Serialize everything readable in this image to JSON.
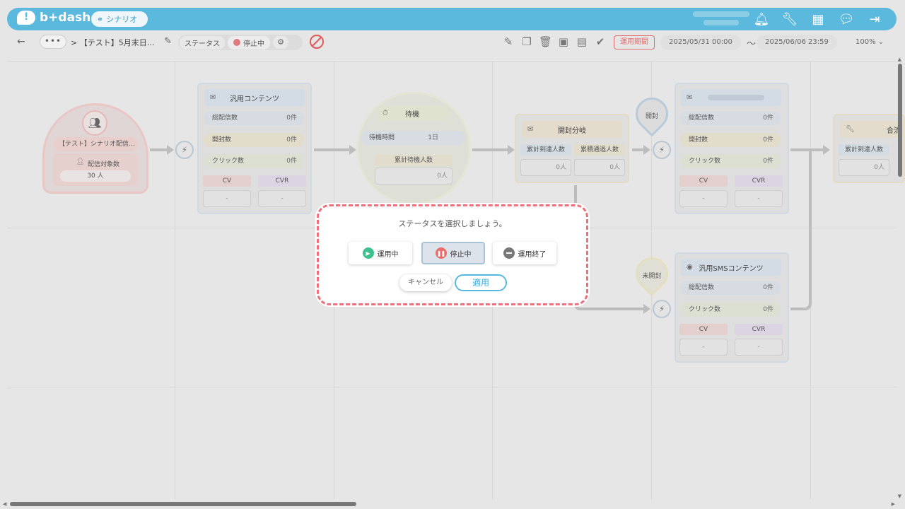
{
  "header": {
    "logo": "b+dash",
    "scenario_chip": "シナリオ",
    "icons": [
      "bell-icon",
      "wrench-icon",
      "grid-icon",
      "chat-icon",
      "logout-icon"
    ]
  },
  "toolbar": {
    "back": "←",
    "more": "•••",
    "breadcrumb": "> 【テスト】5月末日…",
    "status_label": "ステータス",
    "status_value": "停止中",
    "period_badge": "運用期間",
    "start_date": "2025/05/31 00:00",
    "tilde": "〜",
    "end_date": "2025/06/06 23:59",
    "zoom": "100%"
  },
  "nodes": {
    "start": {
      "title": "【テスト】シナリオ配信…",
      "target_label": "配信対象数",
      "target_value": "30 人"
    },
    "content1": {
      "title": "汎用コンテンツ",
      "r1": "総配信数",
      "v1": "0件",
      "r2": "開封数",
      "v2": "0件",
      "r3": "クリック数",
      "v3": "0件",
      "cv": "CV",
      "cvr": "CVR",
      "cv_val": "-",
      "cvr_val": "-"
    },
    "wait": {
      "title": "待機",
      "r1": "待機時間",
      "v1": "1日",
      "r2": "累計待機人数",
      "v2": "0人"
    },
    "branch": {
      "title": "開封分岐",
      "c1": "累計到達人数",
      "c2": "累積通過人数",
      "v1": "0人",
      "v2": "0人"
    },
    "pin_open": "開封",
    "pin_unopened": "未開封",
    "content2": {
      "r1": "総配信数",
      "v1": "0件",
      "r2": "開封数",
      "v2": "0件",
      "r3": "クリック数",
      "v3": "0件",
      "cv": "CV",
      "cvr": "CVR",
      "cv_val": "-",
      "cvr_val": "-"
    },
    "sms": {
      "title": "汎用SMSコンテンツ",
      "r1": "総配信数",
      "v1": "0件",
      "r2": "クリック数",
      "v2": "0件",
      "cv": "CV",
      "cvr": "CVR",
      "cv_val": "-",
      "cvr_val": "-"
    },
    "merge": {
      "title": "合流",
      "r1": "累計到達人数",
      "v1": "0人"
    }
  },
  "dialog": {
    "title": "ステータスを選択しましょう。",
    "options": [
      "運用中",
      "停止中",
      "運用終了"
    ],
    "selected": "停止中",
    "cancel": "キャンセル",
    "apply": "適用"
  }
}
